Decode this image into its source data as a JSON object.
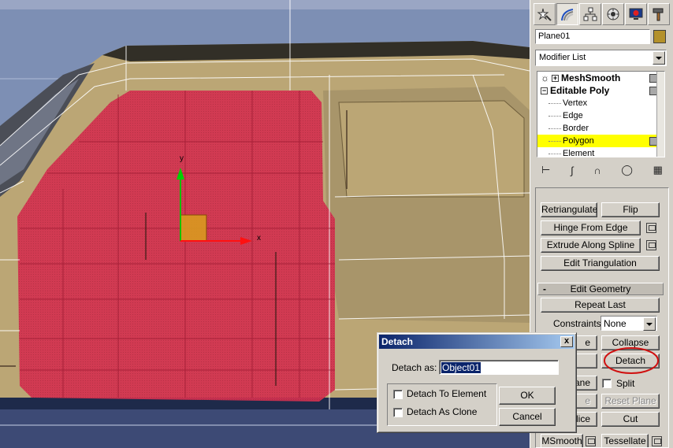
{
  "viewport": {
    "gizmo_y_label": "y",
    "gizmo_x_label": "x"
  },
  "command_panel": {
    "tabs": [
      {
        "name": "create-tab",
        "icon": "cursor-star-icon"
      },
      {
        "name": "modify-tab",
        "icon": "modify-rainbow-icon"
      },
      {
        "name": "hierarchy-tab",
        "icon": "hierarchy-icon"
      },
      {
        "name": "motion-tab",
        "icon": "motion-icon"
      },
      {
        "name": "display-tab",
        "icon": "display-icon"
      },
      {
        "name": "utilities-tab",
        "icon": "hammer-icon"
      }
    ],
    "object_name": "Plane01",
    "object_color": "#b4912a",
    "modifier_list_label": "Modifier List",
    "stack": [
      {
        "label": "MeshSmooth",
        "bold": true,
        "expander": "+",
        "selected": false
      },
      {
        "label": "Editable Poly",
        "bold": true,
        "expander": "−",
        "selected": false
      },
      {
        "label": "Vertex",
        "bold": false,
        "selected": false
      },
      {
        "label": "Edge",
        "bold": false,
        "selected": false
      },
      {
        "label": "Border",
        "bold": false,
        "selected": false
      },
      {
        "label": "Polygon",
        "bold": false,
        "selected": true
      },
      {
        "label": "Element",
        "bold": false,
        "selected": false
      }
    ],
    "buttons": {
      "retriangulate": "Retriangulate",
      "flip": "Flip",
      "hinge_from_edge": "Hinge From Edge",
      "extrude_along_spline": "Extrude Along Spline",
      "edit_triangulation": "Edit Triangulation",
      "repeat_last": "Repeat Last",
      "collapse_partial": "e",
      "collapse": "Collapse",
      "detach": "Detach",
      "slice_plane_partial": "lane",
      "split": "Split",
      "reset_plane_partial": "e",
      "reset_plane": "Reset Plane",
      "slice_partial": "lice",
      "cut": "Cut",
      "msmooth": "MSmooth",
      "tessellate": "Tessellate"
    },
    "edit_geometry_title": "Edit Geometry",
    "edit_geometry_collapse": "-",
    "constraints_label": "Constraints:",
    "constraints_value": "None"
  },
  "detach_dialog": {
    "title": "Detach",
    "close": "x",
    "detach_as_label": "Detach as:",
    "detach_as_value": "Object01",
    "detach_to_element": "Detach To Element",
    "detach_as_clone": "Detach As Clone",
    "ok": "OK",
    "cancel": "Cancel"
  }
}
